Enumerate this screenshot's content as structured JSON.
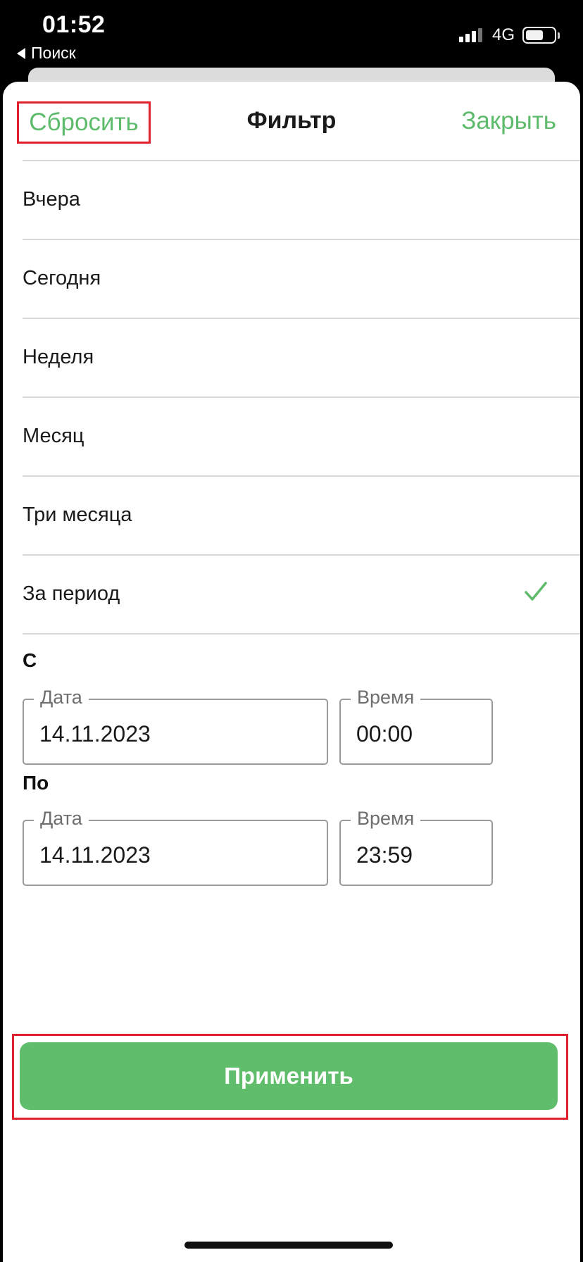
{
  "status_bar": {
    "time": "01:52",
    "back_label": "Поиск",
    "network": "4G"
  },
  "header": {
    "reset_label": "Сбросить",
    "title": "Фильтр",
    "close_label": "Закрыть"
  },
  "periods": [
    {
      "label": "Вчера",
      "selected": false
    },
    {
      "label": "Сегодня",
      "selected": false
    },
    {
      "label": "Неделя",
      "selected": false
    },
    {
      "label": "Месяц",
      "selected": false
    },
    {
      "label": "Три месяца",
      "selected": false
    },
    {
      "label": "За период",
      "selected": true
    }
  ],
  "from": {
    "label": "С",
    "date_legend": "Дата",
    "date_value": "14.11.2023",
    "time_legend": "Время",
    "time_value": "00:00"
  },
  "to": {
    "label": "По",
    "date_legend": "Дата",
    "date_value": "14.11.2023",
    "time_legend": "Время",
    "time_value": "23:59"
  },
  "apply_label": "Применить",
  "colors": {
    "accent": "#5dbb6b",
    "highlight": "#e0202a"
  }
}
